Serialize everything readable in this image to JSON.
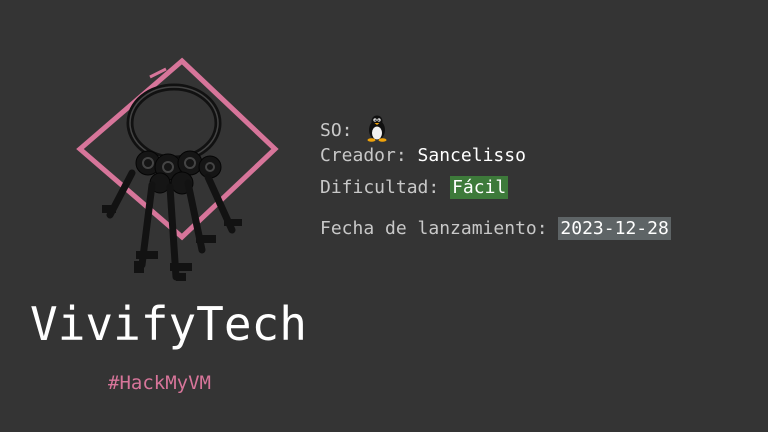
{
  "info": {
    "os_label": "SO:",
    "os_icon": "linux-tux-icon",
    "creator_label": "Creador:",
    "creator_value": "Sancelisso",
    "difficulty_label": "Dificultad:",
    "difficulty_value": "Fácil",
    "date_label": "Fecha de lanzamiento:",
    "date_value": "2023-12-28"
  },
  "title": "VivifyTech",
  "tag": "#HackMyVM",
  "logo_icon": "keyring-icon",
  "colors": {
    "background": "#343434",
    "accent_pink": "#d7759a",
    "difficulty_green": "#3d7a3a",
    "date_gray": "#5e6466"
  }
}
